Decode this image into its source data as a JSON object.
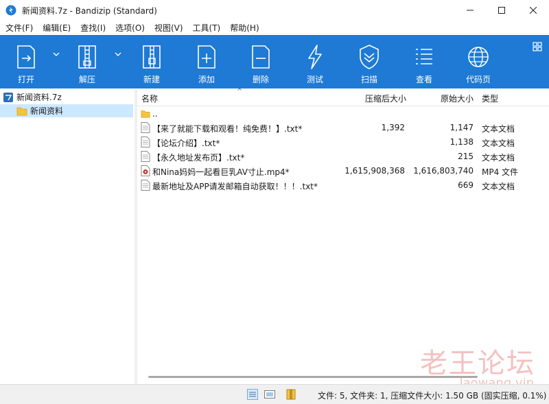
{
  "window": {
    "title": "新闻资料.7z - Bandizip (Standard)"
  },
  "menu": [
    "文件(F)",
    "编辑(E)",
    "查找(I)",
    "选项(O)",
    "视图(V)",
    "工具(T)",
    "帮助(H)"
  ],
  "toolbar": {
    "open": "打开",
    "extract": "解压",
    "new": "新建",
    "add": "添加",
    "delete": "删除",
    "test": "测试",
    "scan": "扫描",
    "view": "查看",
    "codepage": "代码页"
  },
  "tree": {
    "root": "新闻资料.7z",
    "child": "新闻资料"
  },
  "columns": {
    "name": "名称",
    "compressed": "压缩后大小",
    "original": "原始大小",
    "type": "类型"
  },
  "files": [
    {
      "name": "..",
      "compressed": "",
      "original": "",
      "type": "",
      "icon": "folder-icon"
    },
    {
      "name": "【来了就能下载和观看！纯免费！】.txt*",
      "compressed": "1,392",
      "original": "1,147",
      "type": "文本文档",
      "icon": "text-file-icon"
    },
    {
      "name": "【论坛介绍】.txt*",
      "compressed": "",
      "original": "1,138",
      "type": "文本文档",
      "icon": "text-file-icon"
    },
    {
      "name": "【永久地址发布页】.txt*",
      "compressed": "",
      "original": "215",
      "type": "文本文档",
      "icon": "text-file-icon"
    },
    {
      "name": "和Nina妈妈一起看巨乳AV寸止.mp4*",
      "compressed": "1,615,908,368",
      "original": "1,616,803,740",
      "type": "MP4 文件",
      "icon": "video-file-icon"
    },
    {
      "name": "最新地址及APP请发邮箱自动获取！！！.txt*",
      "compressed": "",
      "original": "669",
      "type": "文本文档",
      "icon": "text-file-icon"
    }
  ],
  "status": {
    "text": "文件: 5, 文件夹: 1, 压缩文件大小: 1.50 GB (固实压缩, 0.1%)"
  },
  "watermark": {
    "line1": "老王论坛",
    "line2": "laowang.vip"
  },
  "colors": {
    "toolbar": "#1e7ad4",
    "selection": "#cce8ff"
  }
}
